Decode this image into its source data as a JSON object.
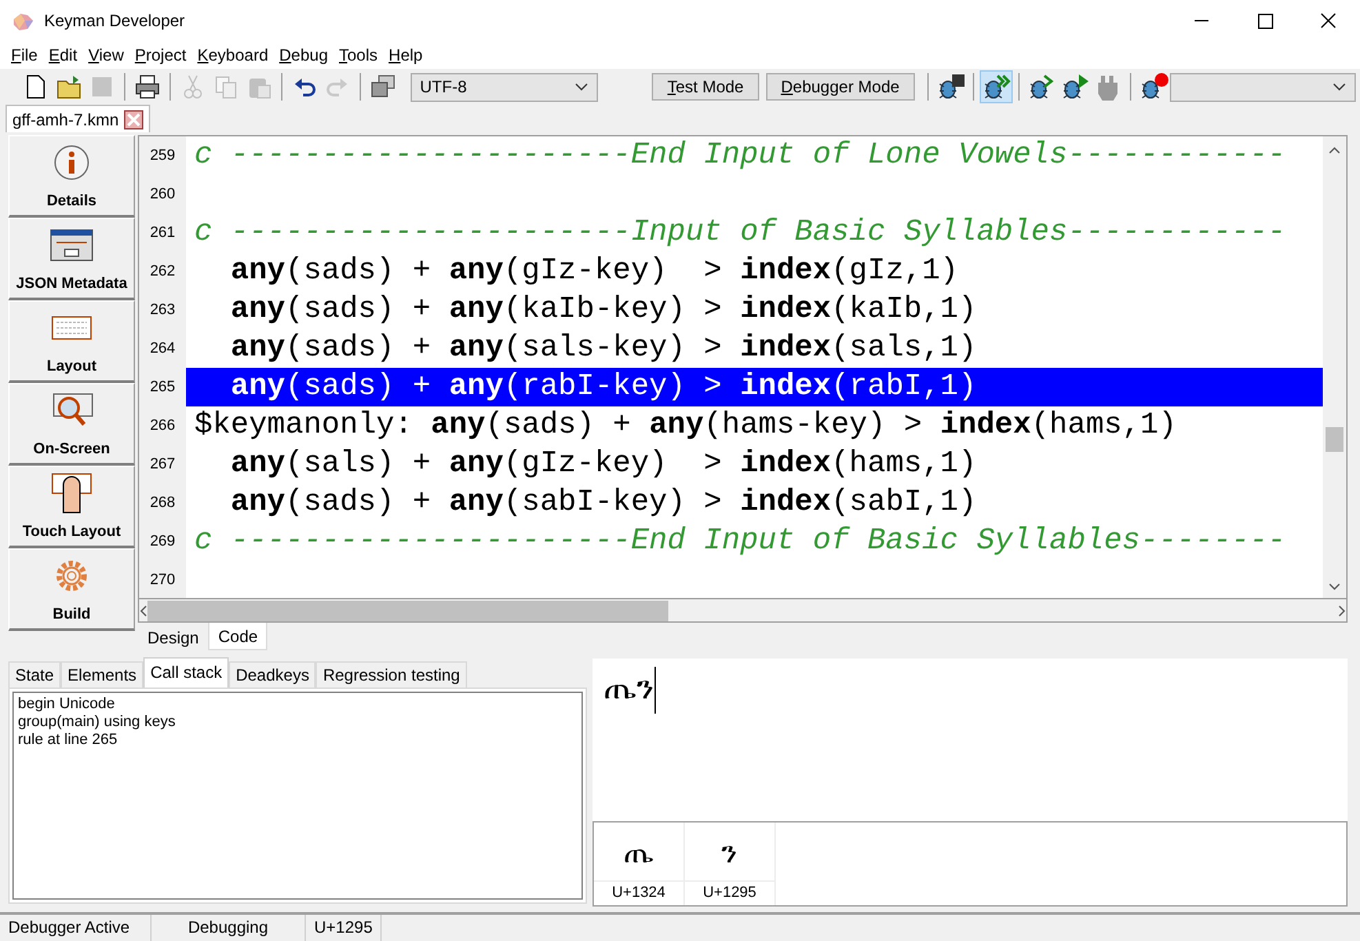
{
  "window": {
    "title": "Keyman Developer"
  },
  "menu": [
    "File",
    "Edit",
    "View",
    "Project",
    "Keyboard",
    "Debug",
    "Tools",
    "Help"
  ],
  "toolbar": {
    "icons": [
      {
        "kind": "new",
        "disabled": false
      },
      {
        "kind": "open",
        "disabled": false
      },
      {
        "kind": "save",
        "disabled": true
      },
      {
        "kind": "sep"
      },
      {
        "kind": "print",
        "disabled": false
      },
      {
        "kind": "sep"
      },
      {
        "kind": "cut",
        "disabled": true
      },
      {
        "kind": "copy",
        "disabled": true
      },
      {
        "kind": "paste",
        "disabled": true
      },
      {
        "kind": "sep"
      },
      {
        "kind": "undo",
        "disabled": false
      },
      {
        "kind": "redo",
        "disabled": true
      },
      {
        "kind": "sep"
      },
      {
        "kind": "windows",
        "disabled": false
      }
    ],
    "encoding": "UTF-8",
    "mode_buttons": [
      "Test Mode",
      "Debugger Mode"
    ],
    "debug_icons": [
      {
        "kind": "stop",
        "on": false
      },
      {
        "kind": "sep"
      },
      {
        "kind": "run",
        "on": true
      },
      {
        "kind": "sep"
      },
      {
        "kind": "step",
        "on": false
      },
      {
        "kind": "play",
        "on": false
      },
      {
        "kind": "pause",
        "on": false
      },
      {
        "kind": "sep"
      },
      {
        "kind": "breakpoint",
        "on": false
      }
    ]
  },
  "file_tab": "gff-amh-7.kmn",
  "sidebar": [
    {
      "kind": "info",
      "label": "Details"
    },
    {
      "kind": "form",
      "label": "JSON Metadata"
    },
    {
      "kind": "keyboard",
      "label": "Layout"
    },
    {
      "kind": "magnifier",
      "label": "On-Screen"
    },
    {
      "kind": "touch",
      "label": "Touch Layout"
    },
    {
      "kind": "gear",
      "label": "Build"
    }
  ],
  "editor": {
    "lines": [
      {
        "number": "259",
        "selected": false,
        "segments": [
          {
            "kind": "comment",
            "text": "c ----------------------End Input of Lone Vowels------------"
          }
        ]
      },
      {
        "number": "260",
        "selected": false
      },
      {
        "number": "261",
        "selected": false,
        "segments": [
          {
            "kind": "comment",
            "text": "c ----------------------Input of Basic Syllables------------"
          }
        ]
      },
      {
        "number": "262",
        "selected": false,
        "indented": true,
        "segments": [
          {
            "kind": "keyword",
            "text": "any"
          },
          {
            "kind": "plain",
            "text": "(sads) + "
          },
          {
            "kind": "keyword",
            "text": "any"
          },
          {
            "kind": "plain",
            "text": "(gIz-key)  > "
          },
          {
            "kind": "keyword",
            "text": "index"
          },
          {
            "kind": "plain",
            "text": "(gIz,1)"
          }
        ]
      },
      {
        "number": "263",
        "selected": false,
        "indented": true,
        "segments": [
          {
            "kind": "keyword",
            "text": "any"
          },
          {
            "kind": "plain",
            "text": "(sads) + "
          },
          {
            "kind": "keyword",
            "text": "any"
          },
          {
            "kind": "plain",
            "text": "(kaIb-key) > "
          },
          {
            "kind": "keyword",
            "text": "index"
          },
          {
            "kind": "plain",
            "text": "(kaIb,1)"
          }
        ]
      },
      {
        "number": "264",
        "selected": false,
        "indented": true,
        "segments": [
          {
            "kind": "keyword",
            "text": "any"
          },
          {
            "kind": "plain",
            "text": "(sads) + "
          },
          {
            "kind": "keyword",
            "text": "any"
          },
          {
            "kind": "plain",
            "text": "(sals-key) > "
          },
          {
            "kind": "keyword",
            "text": "index"
          },
          {
            "kind": "plain",
            "text": "(sals,1)"
          }
        ]
      },
      {
        "number": "265",
        "selected": true,
        "indented": true,
        "segments": [
          {
            "kind": "keyword",
            "text": "any"
          },
          {
            "kind": "plain",
            "text": "(sads) + "
          },
          {
            "kind": "keyword",
            "text": "any"
          },
          {
            "kind": "plain",
            "text": "(rabI-key) > "
          },
          {
            "kind": "keyword",
            "text": "index"
          },
          {
            "kind": "plain",
            "text": "(rabI,1)"
          }
        ]
      },
      {
        "number": "266",
        "selected": false,
        "segments": [
          {
            "kind": "plain",
            "text": "$keymanonly: "
          },
          {
            "kind": "keyword",
            "text": "any"
          },
          {
            "kind": "plain",
            "text": "(sads) + "
          },
          {
            "kind": "keyword",
            "text": "any"
          },
          {
            "kind": "plain",
            "text": "(hams-key) > "
          },
          {
            "kind": "keyword",
            "text": "index"
          },
          {
            "kind": "plain",
            "text": "(hams,1)"
          }
        ]
      },
      {
        "number": "267",
        "selected": false,
        "indented": true,
        "segments": [
          {
            "kind": "keyword",
            "text": "any"
          },
          {
            "kind": "plain",
            "text": "(sals) + "
          },
          {
            "kind": "keyword",
            "text": "any"
          },
          {
            "kind": "plain",
            "text": "(gIz-key)  > "
          },
          {
            "kind": "keyword",
            "text": "index"
          },
          {
            "kind": "plain",
            "text": "(hams,1)"
          }
        ]
      },
      {
        "number": "268",
        "selected": false,
        "indented": true,
        "segments": [
          {
            "kind": "keyword",
            "text": "any"
          },
          {
            "kind": "plain",
            "text": "(sads) + "
          },
          {
            "kind": "keyword",
            "text": "any"
          },
          {
            "kind": "plain",
            "text": "(sabI-key) > "
          },
          {
            "kind": "keyword",
            "text": "index"
          },
          {
            "kind": "plain",
            "text": "(sabI,1)"
          }
        ]
      },
      {
        "number": "269",
        "selected": false,
        "segments": [
          {
            "kind": "comment",
            "text": "c ----------------------End Input of Basic Syllables--------"
          }
        ]
      },
      {
        "number": "270",
        "selected": false
      }
    ]
  },
  "editor_tabs": [
    {
      "label": "Design",
      "selected": false
    },
    {
      "label": "Code",
      "selected": true
    }
  ],
  "debug_tabs": [
    {
      "label": "State",
      "selected": false
    },
    {
      "label": "Elements",
      "selected": false
    },
    {
      "label": "Call stack",
      "selected": true
    },
    {
      "label": "Deadkeys",
      "selected": false
    },
    {
      "label": "Regression testing",
      "selected": false
    }
  ],
  "call_stack": [
    "begin Unicode",
    "group(main) using keys",
    "rule at line 265"
  ],
  "output_text": "ጤን",
  "characters": [
    {
      "glyph": "ጤ",
      "code": "U+1324"
    },
    {
      "glyph": "ን",
      "code": "U+1295"
    }
  ],
  "status_bar": [
    "Debugger Active",
    "Debugging",
    "U+1295"
  ]
}
